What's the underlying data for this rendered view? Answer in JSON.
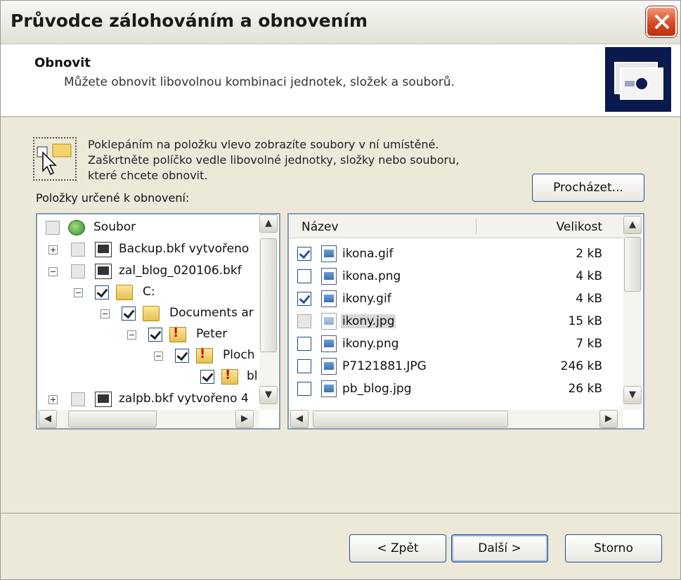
{
  "window": {
    "title": "Průvodce zálohováním a obnovením"
  },
  "header": {
    "title": "Obnovit",
    "subtitle": "Můžete obnovit libovolnou kombinaci jednotek, složek a souborů."
  },
  "hint": {
    "lines": [
      "Poklepáním na položku vlevo zobrazíte soubory v ní umístěné.",
      "Zaškrtněte políčko vedle libovolné jednotky, složky nebo souboru,",
      "které chcete obnovit."
    ]
  },
  "browse_button": "Procházet...",
  "tree": {
    "label": "Položky určené k obnovení:",
    "items": [
      {
        "label": "Soubor",
        "icon": "globe-icon",
        "check": "gray"
      },
      {
        "label": "Backup.bkf vytvořeno",
        "icon": "backup-file-icon",
        "check": "gray",
        "expander": "plus"
      },
      {
        "label": "zal_blog_020106.bkf",
        "icon": "backup-file-icon",
        "check": "gray",
        "expander": "minus"
      },
      {
        "label": "C:",
        "icon": "drive-icon",
        "check": "tri",
        "expander": "minus"
      },
      {
        "label": "Documents ar",
        "icon": "folder-icon",
        "check": "tri",
        "expander": "minus"
      },
      {
        "label": "Peter",
        "icon": "warning-folder-icon",
        "check": "tri",
        "expander": "minus"
      },
      {
        "label": "Ploch",
        "icon": "warning-folder-icon",
        "check": "tri",
        "expander": "minus"
      },
      {
        "label": "bl",
        "icon": "warning-folder-icon",
        "check": "checked"
      },
      {
        "label": "zalpb.bkf vytvořeno 4",
        "icon": "backup-file-icon",
        "check": "gray",
        "expander": "plus"
      }
    ]
  },
  "files": {
    "col_name": "Název",
    "col_size": "Velikost",
    "rows": [
      {
        "name": "ikona.gif",
        "size": "2 kB",
        "checked": true
      },
      {
        "name": "ikona.png",
        "size": "4 kB",
        "checked": false
      },
      {
        "name": "ikony.gif",
        "size": "4 kB",
        "checked": true
      },
      {
        "name": "ikony.jpg",
        "size": "15 kB",
        "checked": false,
        "selected": true
      },
      {
        "name": "ikony.png",
        "size": "7 kB",
        "checked": false
      },
      {
        "name": "P7121881.JPG",
        "size": "246 kB",
        "checked": false
      },
      {
        "name": "pb_blog.jpg",
        "size": "26 kB",
        "checked": false
      }
    ]
  },
  "footer": {
    "back": "< Zpět",
    "next": "Další >",
    "cancel": "Storno"
  },
  "colors": {
    "accent_border": "#7f9db9",
    "header_icon": "#0b1a4e",
    "close_button": "#d9481f"
  }
}
